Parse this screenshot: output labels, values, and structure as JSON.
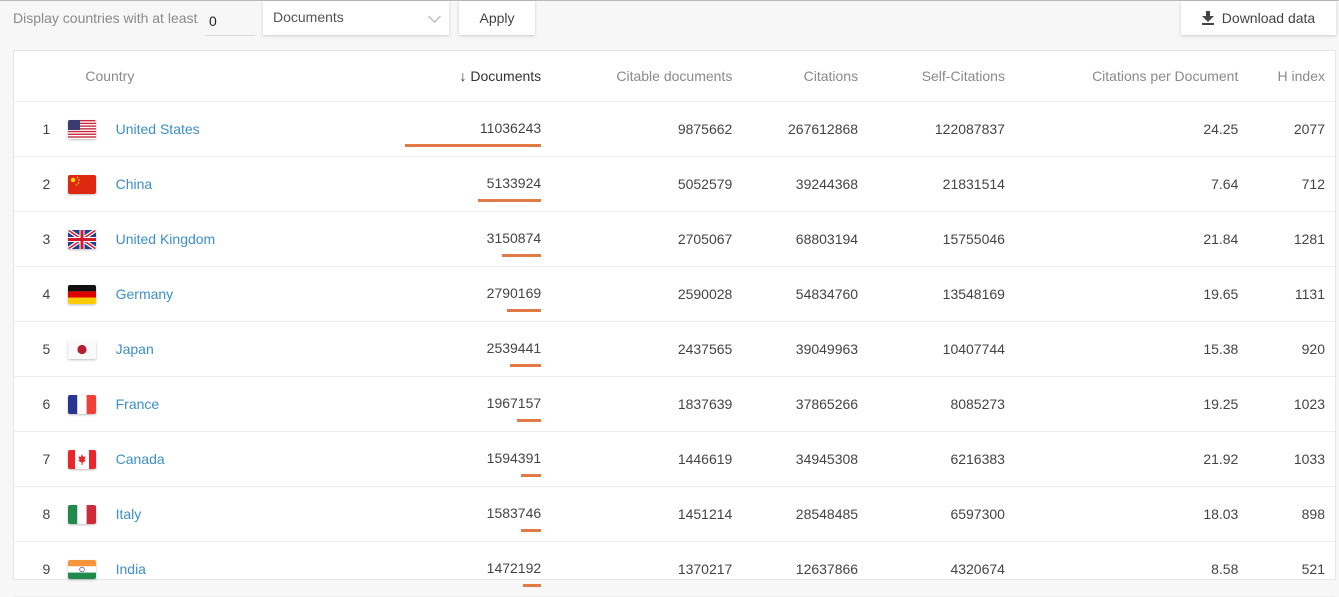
{
  "filter": {
    "label": "Display countries with at least",
    "min_value": "0",
    "metric_selected": "Documents",
    "apply_label": "Apply",
    "download_label": "Download data"
  },
  "colors": {
    "bar": "#e07b47",
    "link": "#3d8fc8"
  },
  "table": {
    "columns": {
      "country": "Country",
      "documents": "Documents",
      "sort_arrow": "↓",
      "citable": "Citable documents",
      "citations": "Citations",
      "self_citations": "Self-Citations",
      "cpd": "Citations per Document",
      "hindex": "H index"
    },
    "rows": [
      {
        "rank": "1",
        "country": "United States",
        "flag": "us",
        "documents": "11036243",
        "doc_share": 1.0,
        "citable": "9875662",
        "citations": "267612868",
        "self_citations": "122087837",
        "cpd": "24.25",
        "hindex": "2077"
      },
      {
        "rank": "2",
        "country": "China",
        "flag": "cn",
        "documents": "5133924",
        "doc_share": 0.465,
        "citable": "5052579",
        "citations": "39244368",
        "self_citations": "21831514",
        "cpd": "7.64",
        "hindex": "712"
      },
      {
        "rank": "3",
        "country": "United Kingdom",
        "flag": "gb",
        "documents": "3150874",
        "doc_share": 0.285,
        "citable": "2705067",
        "citations": "68803194",
        "self_citations": "15755046",
        "cpd": "21.84",
        "hindex": "1281"
      },
      {
        "rank": "4",
        "country": "Germany",
        "flag": "de",
        "documents": "2790169",
        "doc_share": 0.253,
        "citable": "2590028",
        "citations": "54834760",
        "self_citations": "13548169",
        "cpd": "19.65",
        "hindex": "1131"
      },
      {
        "rank": "5",
        "country": "Japan",
        "flag": "jp",
        "documents": "2539441",
        "doc_share": 0.23,
        "citable": "2437565",
        "citations": "39049963",
        "self_citations": "10407744",
        "cpd": "15.38",
        "hindex": "920"
      },
      {
        "rank": "6",
        "country": "France",
        "flag": "fr",
        "documents": "1967157",
        "doc_share": 0.178,
        "citable": "1837639",
        "citations": "37865266",
        "self_citations": "8085273",
        "cpd": "19.25",
        "hindex": "1023"
      },
      {
        "rank": "7",
        "country": "Canada",
        "flag": "ca",
        "documents": "1594391",
        "doc_share": 0.144,
        "citable": "1446619",
        "citations": "34945308",
        "self_citations": "6216383",
        "cpd": "21.92",
        "hindex": "1033"
      },
      {
        "rank": "8",
        "country": "Italy",
        "flag": "it",
        "documents": "1583746",
        "doc_share": 0.144,
        "citable": "1451214",
        "citations": "28548485",
        "self_citations": "6597300",
        "cpd": "18.03",
        "hindex": "898"
      },
      {
        "rank": "9",
        "country": "India",
        "flag": "in",
        "documents": "1472192",
        "doc_share": 0.133,
        "citable": "1370217",
        "citations": "12637866",
        "self_citations": "4320674",
        "cpd": "8.58",
        "hindex": "521"
      }
    ]
  }
}
